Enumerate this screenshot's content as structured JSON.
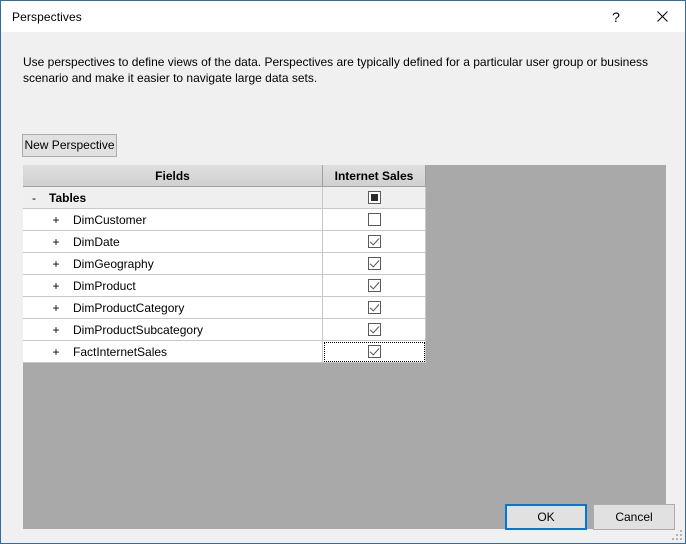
{
  "window": {
    "title": "Perspectives",
    "help_label": "?",
    "close_label": "✕"
  },
  "body": {
    "instructions": "Use perspectives to define views of the data. Perspectives are typically defined for a particular user group or business scenario and make it easier to navigate large data sets.",
    "new_perspective_label": "New Perspective"
  },
  "grid": {
    "columns": [
      "Fields",
      "Internet Sales"
    ],
    "rows": [
      {
        "label": "Tables",
        "expander": "-",
        "level": 1,
        "checkbox": "indeterminate",
        "focused": false
      },
      {
        "label": "DimCustomer",
        "expander": "+",
        "level": 2,
        "checkbox": "unchecked",
        "focused": false
      },
      {
        "label": "DimDate",
        "expander": "+",
        "level": 2,
        "checkbox": "checked",
        "focused": false
      },
      {
        "label": "DimGeography",
        "expander": "+",
        "level": 2,
        "checkbox": "checked",
        "focused": false
      },
      {
        "label": "DimProduct",
        "expander": "+",
        "level": 2,
        "checkbox": "checked",
        "focused": false
      },
      {
        "label": "DimProductCategory",
        "expander": "+",
        "level": 2,
        "checkbox": "checked",
        "focused": false
      },
      {
        "label": "DimProductSubcategory",
        "expander": "+",
        "level": 2,
        "checkbox": "checked",
        "focused": false
      },
      {
        "label": "FactInternetSales",
        "expander": "+",
        "level": 2,
        "checkbox": "checked",
        "focused": true
      }
    ]
  },
  "footer": {
    "ok_label": "OK",
    "cancel_label": "Cancel"
  },
  "colors": {
    "accent": "#0078d7",
    "window_border": "#2b6ea3",
    "dialog_bg": "#f0f0f0",
    "grid_empty_bg": "#a9a9a9",
    "header_bg": "#d6d6d6"
  }
}
